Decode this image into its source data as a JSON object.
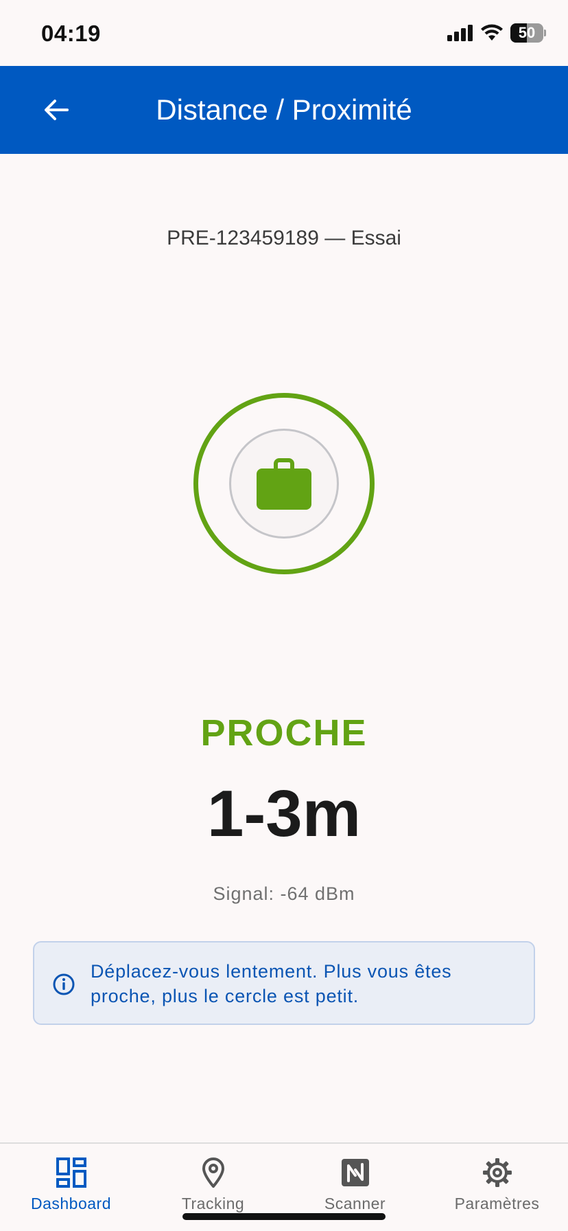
{
  "status_bar": {
    "time": "04:19",
    "battery_level": "50"
  },
  "app_bar": {
    "title": "Distance / Proximité"
  },
  "device": {
    "label": "PRE-123459189 — Essai"
  },
  "proximity": {
    "status": "PROCHE",
    "distance": "1-3m",
    "signal": "Signal: -64 dBm"
  },
  "info": {
    "message": "Déplacez-vous lentement. Plus vous êtes proche, plus le cercle est petit."
  },
  "nav": {
    "items": [
      {
        "label": "Dashboard",
        "icon": "dashboard-icon",
        "active": true
      },
      {
        "label": "Tracking",
        "icon": "location-pin-icon",
        "active": false
      },
      {
        "label": "Scanner",
        "icon": "nfc-icon",
        "active": false
      },
      {
        "label": "Paramètres",
        "icon": "gear-icon",
        "active": false
      }
    ]
  },
  "colors": {
    "primary": "#0059c1",
    "proximity_green": "#62a314",
    "info_text": "#0b55b3"
  }
}
